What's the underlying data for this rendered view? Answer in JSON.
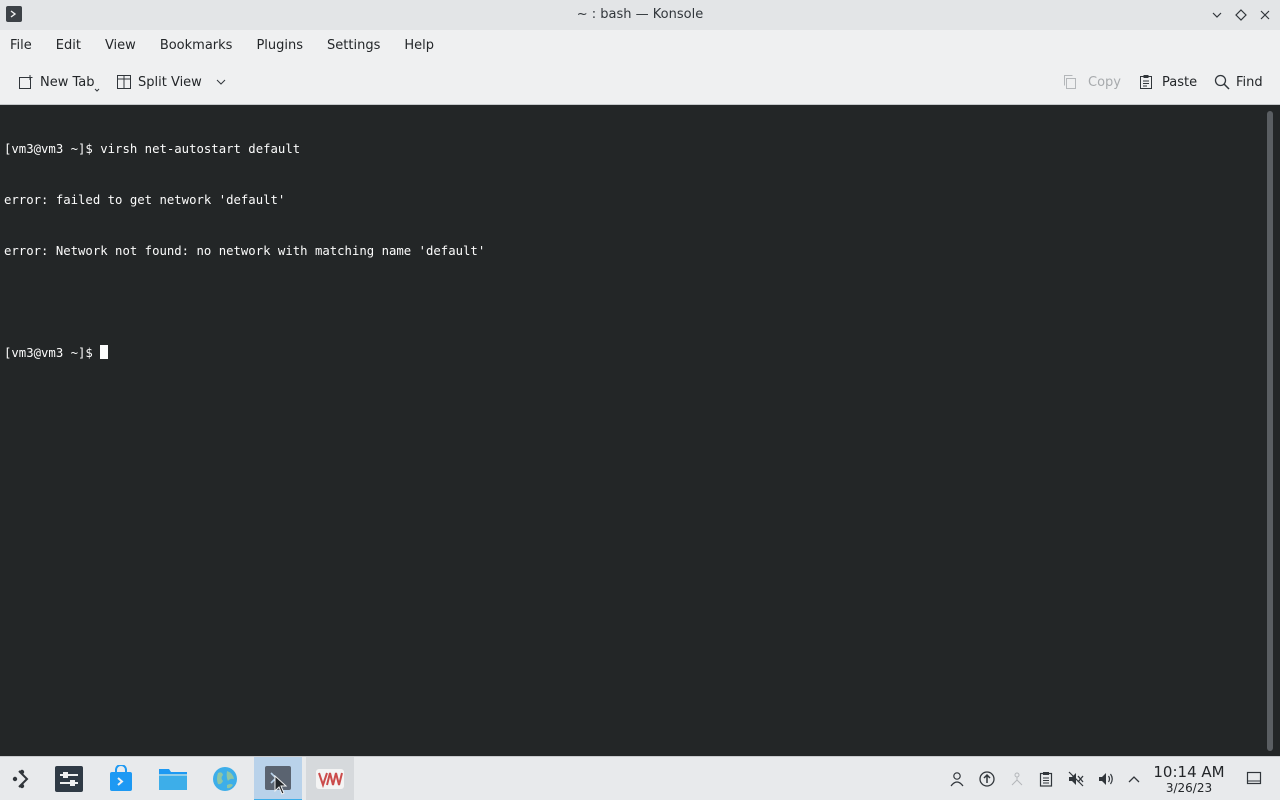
{
  "window": {
    "title": "~ : bash — Konsole",
    "app_icon": "konsole-icon",
    "controls": [
      "minimize-icon",
      "maximize-icon",
      "close-icon"
    ]
  },
  "menubar": {
    "items": [
      "File",
      "Edit",
      "View",
      "Bookmarks",
      "Plugins",
      "Settings",
      "Help"
    ]
  },
  "toolbar": {
    "new_tab": "New Tab",
    "split_view": "Split View",
    "copy": "Copy",
    "paste": "Paste",
    "find": "Find"
  },
  "terminal": {
    "lines": [
      "[vm3@vm3 ~]$ virsh net-autostart default",
      "error: failed to get network 'default'",
      "error: Network not found: no network with matching name 'default'",
      "",
      "[vm3@vm3 ~]$ "
    ],
    "background": "#232627",
    "foreground": "#fcfcfc"
  },
  "taskbar": {
    "apps": [
      {
        "name": "application-launcher-icon"
      },
      {
        "name": "system-settings-icon"
      },
      {
        "name": "discover-store-icon"
      },
      {
        "name": "file-manager-icon"
      },
      {
        "name": "web-browser-icon"
      },
      {
        "name": "konsole-icon"
      },
      {
        "name": "virt-manager-icon"
      }
    ],
    "tray": [
      "user-icon",
      "updates-icon",
      "network-disabled-icon",
      "clipboard-icon",
      "audio-muted-icon",
      "volume-icon",
      "expand-tray-icon"
    ],
    "clock_time": "10:14 AM",
    "clock_date": "3/26/23",
    "show_desktop": "show-desktop-icon"
  },
  "colors": {
    "accent": "#3daee9",
    "titlebar": "#e3e5e7",
    "panel": "#e8eaec"
  }
}
